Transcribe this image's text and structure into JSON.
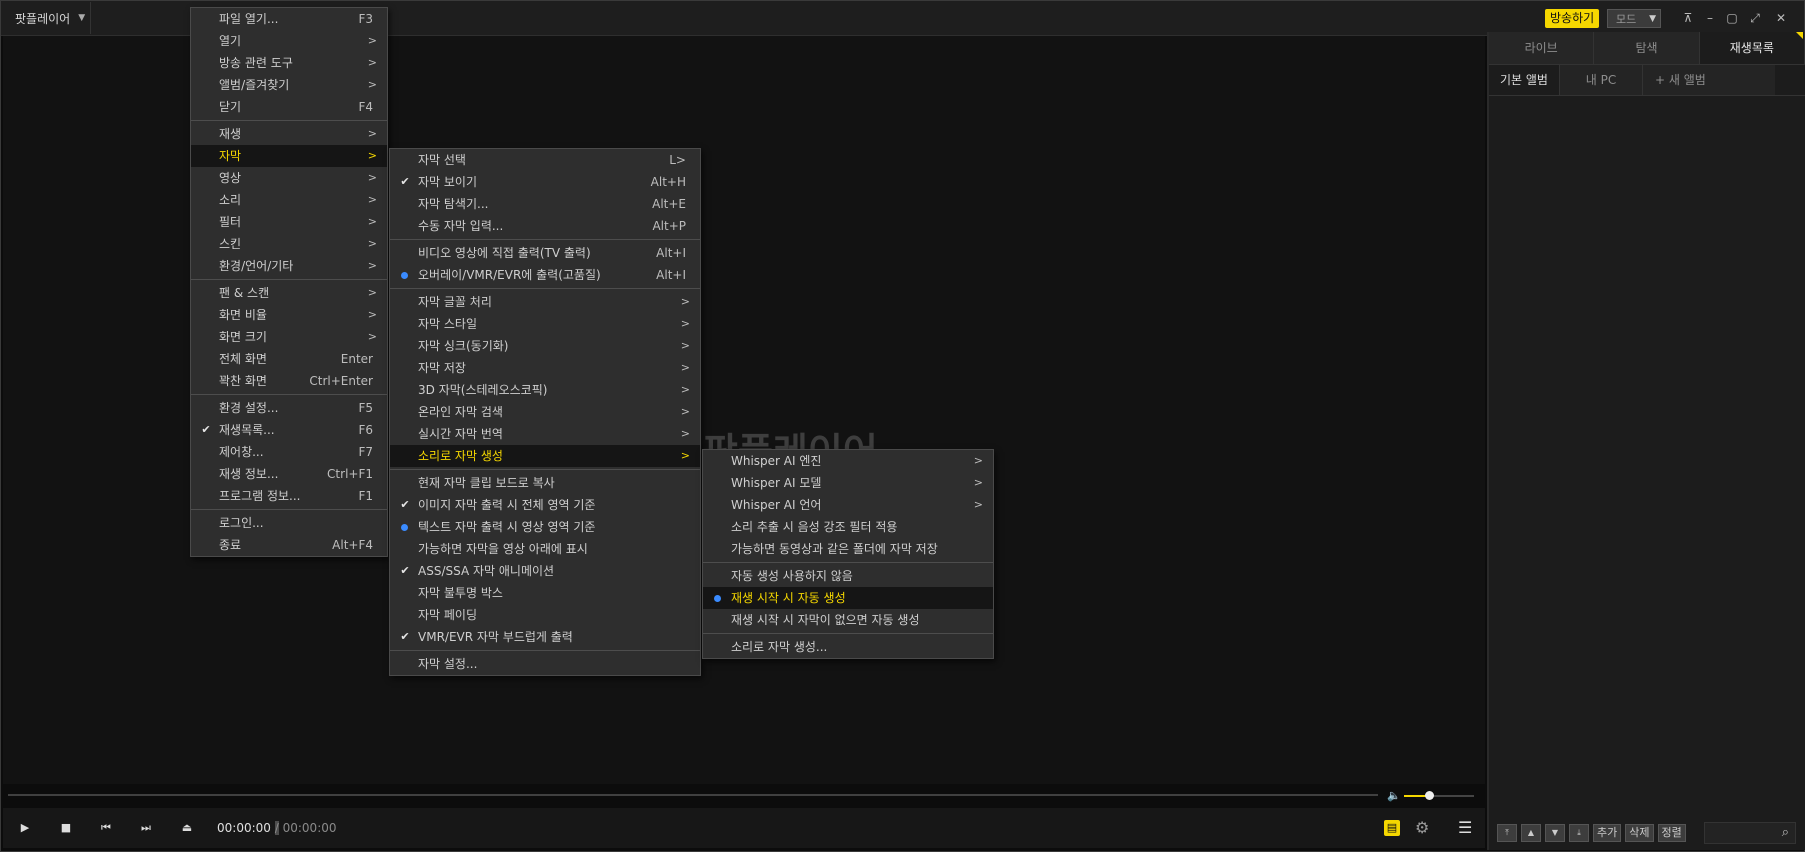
{
  "app": {
    "title": "팟플레이어",
    "watermark": "팟플레이어"
  },
  "titlebar": {
    "broadcast": "방송하기",
    "mode": "모드"
  },
  "time": {
    "current": "00:00:00",
    "separator": "/",
    "total": "00:00:00"
  },
  "volume": {
    "level": 0.35
  },
  "tabs": [
    "라이브",
    "탐색",
    "재생목록"
  ],
  "albums": {
    "default": "기본 앨범",
    "mypc": "내 PC",
    "new": "+ 새 앨범"
  },
  "playlist_toolbar": {
    "add": "추가",
    "delete": "삭제",
    "sort": "정렬"
  },
  "main_menu": [
    {
      "label": "파일 열기...",
      "shortcut": "F3"
    },
    {
      "label": "열기",
      "arrow": ">"
    },
    {
      "label": "방송 관련 도구",
      "arrow": ">"
    },
    {
      "label": "앨범/즐겨찾기",
      "arrow": ">"
    },
    {
      "label": "닫기",
      "shortcut": "F4"
    },
    {
      "sep": true
    },
    {
      "label": "재생",
      "arrow": ">"
    },
    {
      "label": "자막",
      "arrow": ">",
      "highlight": true
    },
    {
      "label": "영상",
      "arrow": ">"
    },
    {
      "label": "소리",
      "arrow": ">"
    },
    {
      "label": "필터",
      "arrow": ">"
    },
    {
      "label": "스킨",
      "arrow": ">"
    },
    {
      "label": "환경/언어/기타",
      "arrow": ">"
    },
    {
      "sep": true
    },
    {
      "label": "팬 & 스캔",
      "arrow": ">"
    },
    {
      "label": "화면 비율",
      "arrow": ">"
    },
    {
      "label": "화면 크기",
      "arrow": ">"
    },
    {
      "label": "전체 화면",
      "shortcut": "Enter"
    },
    {
      "label": "꽉찬 화면",
      "shortcut": "Ctrl+Enter"
    },
    {
      "sep": true
    },
    {
      "label": "환경 설정...",
      "shortcut": "F5"
    },
    {
      "label": "재생목록...",
      "shortcut": "F6",
      "mark": "check"
    },
    {
      "label": "제어창...",
      "shortcut": "F7"
    },
    {
      "label": "재생 정보...",
      "shortcut": "Ctrl+F1"
    },
    {
      "label": "프로그램 정보...",
      "shortcut": "F1"
    },
    {
      "sep": true
    },
    {
      "label": "로그인..."
    },
    {
      "label": "종료",
      "shortcut": "Alt+F4"
    }
  ],
  "subtitle_menu": [
    {
      "label": "자막 선택",
      "shortcut": "L>"
    },
    {
      "label": "자막 보이기",
      "shortcut": "Alt+H",
      "mark": "check"
    },
    {
      "label": "자막 탐색기...",
      "shortcut": "Alt+E"
    },
    {
      "label": "수동 자막 입력...",
      "shortcut": "Alt+P"
    },
    {
      "sep": true
    },
    {
      "label": "비디오 영상에 직접 출력(TV 출력)",
      "shortcut": "Alt+I"
    },
    {
      "label": "오버레이/VMR/EVR에 출력(고품질)",
      "shortcut": "Alt+I",
      "mark": "dot"
    },
    {
      "sep": true
    },
    {
      "label": "자막 글꼴 처리",
      "arrow": ">"
    },
    {
      "label": "자막 스타일",
      "arrow": ">"
    },
    {
      "label": "자막 싱크(동기화)",
      "arrow": ">"
    },
    {
      "label": "자막 저장",
      "arrow": ">"
    },
    {
      "label": "3D 자막(스테레오스코픽)",
      "arrow": ">"
    },
    {
      "label": "온라인 자막 검색",
      "arrow": ">"
    },
    {
      "label": "실시간 자막 번역",
      "arrow": ">"
    },
    {
      "label": "소리로 자막 생성",
      "arrow": ">",
      "highlight": true
    },
    {
      "sep": true
    },
    {
      "label": "현재 자막 클립 보드로 복사"
    },
    {
      "label": "이미지 자막 출력 시 전체 영역 기준",
      "mark": "check"
    },
    {
      "label": "텍스트 자막 출력 시 영상 영역 기준",
      "mark": "dot"
    },
    {
      "label": "가능하면 자막을 영상 아래에 표시"
    },
    {
      "label": "ASS/SSA 자막 애니메이션",
      "mark": "check"
    },
    {
      "label": "자막 불투명 박스"
    },
    {
      "label": "자막 페이딩"
    },
    {
      "label": "VMR/EVR 자막 부드럽게 출력",
      "mark": "check"
    },
    {
      "sep": true
    },
    {
      "label": "자막 설정..."
    }
  ],
  "ai_menu": [
    {
      "label": "Whisper AI 엔진",
      "arrow": ">"
    },
    {
      "label": "Whisper AI 모델",
      "arrow": ">"
    },
    {
      "label": "Whisper AI 언어",
      "arrow": ">"
    },
    {
      "label": "소리 추출 시 음성 강조 필터 적용"
    },
    {
      "label": "가능하면 동영상과 같은 폴더에 자막 저장"
    },
    {
      "sep": true
    },
    {
      "label": "자동 생성 사용하지 않음"
    },
    {
      "label": "재생 시작 시 자동 생성",
      "mark": "dot",
      "highlight": true
    },
    {
      "label": "재생 시작 시 자막이 없으면 자동 생성"
    },
    {
      "sep": true
    },
    {
      "label": "소리로 자막 생성..."
    }
  ],
  "colors": {
    "accent": "#f5d700",
    "radio": "#3a8bff",
    "menu_bg": "#2e2e2e"
  }
}
